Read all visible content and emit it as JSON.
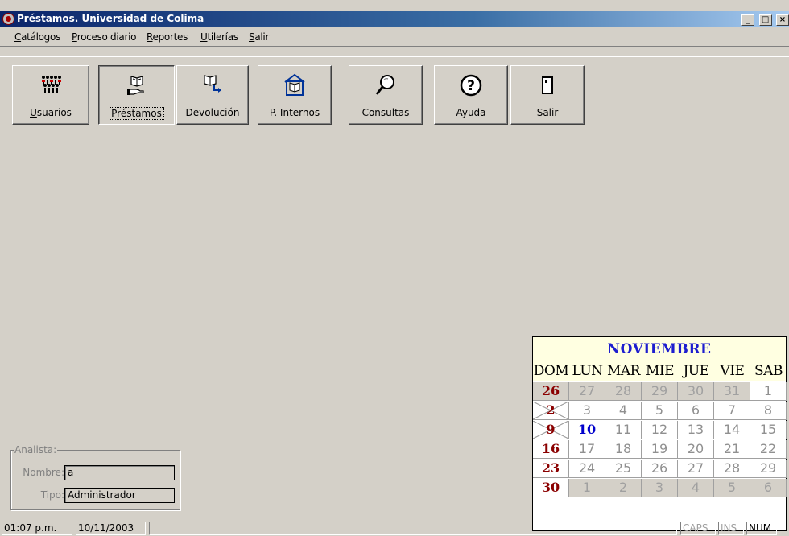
{
  "window": {
    "title": "Préstamos. Universidad de Colima",
    "minimize": "_",
    "maximize": "□",
    "close": "×"
  },
  "menu": [
    "Catálogos",
    "Proceso diario",
    "Reportes",
    "Utilerías",
    "Salir"
  ],
  "toolbar": {
    "buttons": [
      {
        "label": "Usuarios",
        "icon": "users-icon"
      },
      {
        "label": "Préstamos",
        "icon": "book-hand-icon",
        "pressed": true
      },
      {
        "label": "Devolución",
        "icon": "book-return-icon"
      },
      {
        "label": "P. Internos",
        "icon": "library-book-icon"
      },
      {
        "label": "Consultas",
        "icon": "magnifier-icon"
      },
      {
        "label": "Ayuda",
        "icon": "help-icon"
      },
      {
        "label": "Salir",
        "icon": "door-icon"
      }
    ]
  },
  "analyst": {
    "legend": "Analista:",
    "name_label": "Nombre:",
    "name_value": "a",
    "type_label": "Tipo:",
    "type_value": "Administrador"
  },
  "calendar": {
    "month": "NOVIEMBRE",
    "day_names": [
      "DOM",
      "LUN",
      "MAR",
      "MIE",
      "JUE",
      "VIE",
      "SAB"
    ],
    "weeks": [
      [
        "26",
        "27",
        "28",
        "29",
        "30",
        "31",
        "1"
      ],
      [
        "2",
        "3",
        "4",
        "5",
        "6",
        "7",
        "8"
      ],
      [
        "9",
        "10",
        "11",
        "12",
        "13",
        "14",
        "15"
      ],
      [
        "16",
        "17",
        "18",
        "19",
        "20",
        "21",
        "22"
      ],
      [
        "23",
        "24",
        "25",
        "26",
        "27",
        "28",
        "29"
      ],
      [
        "30",
        "1",
        "2",
        "3",
        "4",
        "5",
        "6"
      ]
    ],
    "today": "10"
  },
  "status": {
    "time": "01:07 p.m.",
    "date": "10/11/2003",
    "caps": "CAPS",
    "ins": "INS",
    "num": "NUM"
  }
}
